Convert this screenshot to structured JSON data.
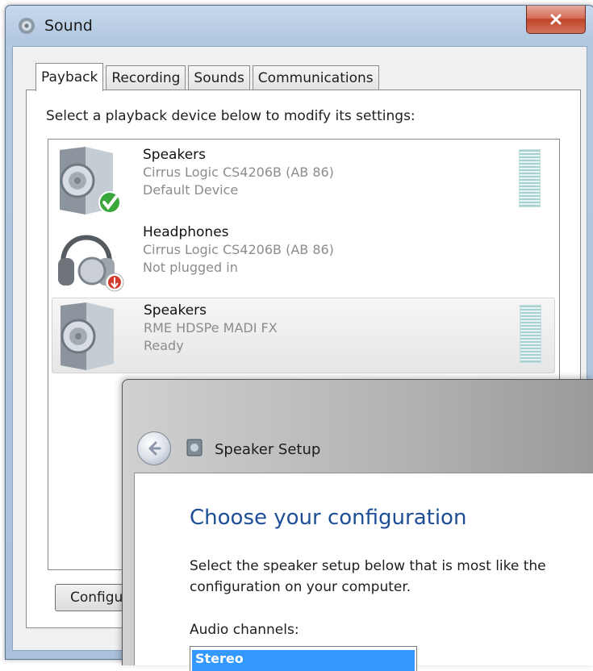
{
  "window": {
    "title": "Sound",
    "close_label": "x",
    "icon": "speaker-settings-icon"
  },
  "tabs": [
    {
      "label": "Payback",
      "active": true
    },
    {
      "label": "Recording",
      "active": false
    },
    {
      "label": "Sounds",
      "active": false
    },
    {
      "label": "Communications",
      "active": false
    }
  ],
  "playback": {
    "instruction": "Select a playback device below to modify its settings:",
    "devices": [
      {
        "name": "Speakers",
        "driver": "Cirrus Logic CS4206B (AB 86)",
        "status": "Default Device",
        "icon": "speaker-icon",
        "badge": "default-check-icon"
      },
      {
        "name": "Headphones",
        "driver": "Cirrus Logic CS4206B (AB 86)",
        "status": "Not plugged in",
        "icon": "headphones-icon",
        "badge": "unplugged-icon"
      },
      {
        "name": "Speakers",
        "driver": "RME HDSPe MADI FX",
        "status": "Ready",
        "icon": "speaker-icon",
        "badge": ""
      }
    ],
    "configure_label": "Configure"
  },
  "speaker_setup": {
    "title": "Speaker Setup",
    "heading": "Choose your configuration",
    "description": "Select the speaker setup below that is most like the configuration on your computer.",
    "channels_label": "Audio channels:",
    "selected_channel": "Stereo"
  },
  "colors": {
    "accent": "#3399ff",
    "heading": "#1e4f96",
    "close": "#c0442a"
  }
}
